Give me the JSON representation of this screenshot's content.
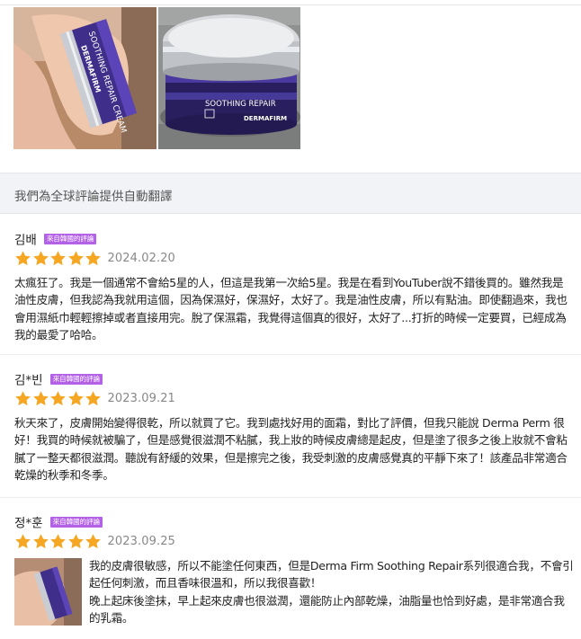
{
  "images": {
    "photo_1": "product-in-hand-photo",
    "photo_2": "product-jar-on-table-photo",
    "photo_1_lettering": "SOOTHING REPAIR CREAM DERMAFIRM",
    "photo_2_lettering": "SOOTHING REPAIR DERMAFIRM"
  },
  "banner": {
    "text": "我們為全球評論提供自動翻譯"
  },
  "colors": {
    "star": "#f5a623",
    "badge": "#b361e6",
    "banner_bg": "#f1f3f6"
  },
  "reviews": [
    {
      "name": "김배",
      "badge": "來自韓國的評論",
      "stars": 5,
      "date": "2024.02.20",
      "text": "太瘋狂了。我是一個通常不會給5星的人，但這是我第一次給5星。我是在看到YouTuber說不錯後買的。雖然我是油性皮膚，但我認為我就用這個，因為保濕好，保濕好，太好了。我是油性皮膚，所以有點油。即使翻過來，我也會用濕紙巾輕輕擦掉或者直接用完。脫了保濕霜，我覺得這個真的很好，太好了...打折的時候一定要買，已經成為我的最愛了哈哈。"
    },
    {
      "name": "김*빈",
      "badge": "來自韓國的評論",
      "stars": 5,
      "date": "2023.09.21",
      "text": "秋天來了，皮膚開始變得很乾，所以就買了它。我到處找好用的面霜，對比了評價，但我只能說 Derma Perm 很好！我買的時候就被騙了，但是感覺很滋潤不粘膩，我上妝的時候皮膚總是起皮，但是塗了很多之後上妝就不會粘膩了一整天都很滋潤。聽說有舒緩的效果，但是擦完之後，我受刺激的皮膚感覺真的平靜下來了！該產品非常適合乾燥的秋季和冬季。"
    },
    {
      "name": "정*훈",
      "badge": "來自韓國的評論",
      "stars": 5,
      "date": "2023.09.25",
      "thumbnail": "review-product-thumbnail",
      "text_line1": "我的皮膚很敏感，所以不能塗任何東西，但是Derma Firm Soothing Repair系列很適合我，不會引起任何刺激，而且香味很溫和，所以我很喜歡！",
      "text_line2": "晚上起床後塗抹，早上起來皮膚也很滋潤，還能防止內部乾燥，油脂量也恰到好處，是非常適合我的乳霜。"
    }
  ]
}
